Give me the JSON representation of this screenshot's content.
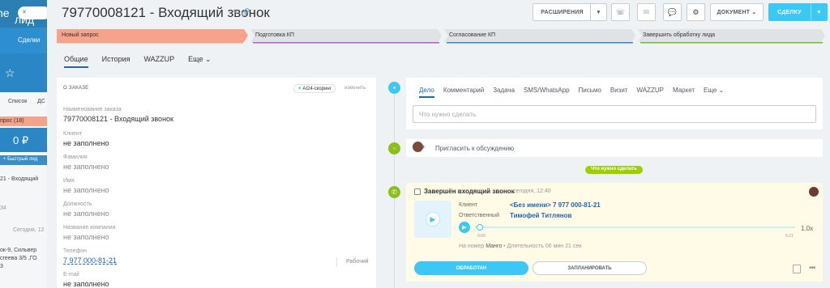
{
  "background": {
    "app_title_fragment": "ne",
    "filter_pill": "лид",
    "deals_label": "Сделки",
    "list_tab": "Список",
    "list_tab_short": "ДС",
    "stage_label": "прос (18)",
    "total_amount": "0 ₽",
    "quick_lead": "+ Быстрый лид",
    "lead_item": "21 - Входящий",
    "lead_item_number": "34",
    "today_label": "Сегодня, 12",
    "address_line1": "ок-9, Сильвер",
    "address_line2": "сгеева 3/5 ,ГО",
    "address_line3": "3"
  },
  "header": {
    "title": "79770008121 - Входящий звонок",
    "edit_icon": "pencil-icon",
    "btn_extensions": "РАСШИРЕНИЯ",
    "btn_dropdown_caret": "▾",
    "btn_phone_icon": "☏",
    "btn_mail_icon": "✉",
    "btn_chat_icon": "💬",
    "btn_settings_icon": "⚙",
    "btn_document": "ДОКУМЕНТ",
    "btn_document_caret": "⌄",
    "btn_deal": "СДЕЛКУ",
    "btn_deal_caret": "▾"
  },
  "stages": [
    {
      "label": "Новый запрос",
      "color": "#f5a38a",
      "underline": "#f5a38a"
    },
    {
      "label": "Подготовка КП",
      "color": "#dfe3e6",
      "underline": "#b457d1"
    },
    {
      "label": "Согласование КП",
      "color": "#dfe3e6",
      "underline": "#2f86d5"
    },
    {
      "label": "Завершить обработку лида",
      "color": "#dfe3e6",
      "underline": "#6cbf2a"
    }
  ],
  "tabs": [
    {
      "label": "Общие",
      "active": true
    },
    {
      "label": "История",
      "active": false
    },
    {
      "label": "WAZZUP",
      "active": false
    },
    {
      "label": "Еще ⌄",
      "active": false
    }
  ],
  "left_card": {
    "heading": "О ЗАКАЗЕ",
    "ai_badge": "AI24-скоринг",
    "change_link": "изменить",
    "fields": [
      {
        "label": "Наименование заказа",
        "value": "79770008121 - Входящий звонок",
        "style": ""
      },
      {
        "label": "Клиент",
        "value": "не заполнено",
        "style": ""
      },
      {
        "label": "Фамилия",
        "value": "не заполнено",
        "style": "muted"
      },
      {
        "label": "Имя",
        "value": "не заполнено",
        "style": "muted"
      },
      {
        "label": "Должность",
        "value": "не заполнено",
        "style": "muted"
      },
      {
        "label": "Название компании",
        "value": "не заполнено",
        "style": "muted"
      },
      {
        "label": "Телефон",
        "value": "7 977 000-81-21",
        "style": "link"
      },
      {
        "label": "E-mail",
        "value": "не заполнено",
        "style": ""
      }
    ],
    "phone_type": "Рабочий"
  },
  "activity": {
    "tabs": [
      "Дело",
      "Комментарий",
      "Задача",
      "SMS/WhatsApp",
      "Письмо",
      "Визит",
      "WAZZUP",
      "Маркет",
      "Еще ⌄"
    ],
    "input_placeholder": "Что нужно сделать",
    "discuss_text": "Пригласить к обсуждению",
    "todo_pill": "Что нужно сделать"
  },
  "call": {
    "title": "Завершён входящий звонок",
    "time": "сегодня, 12:40",
    "client_label": "Клиент",
    "client_value": "<Без имени> 7 977 000-81-21",
    "responsible_label": "Ответственный",
    "responsible_value": "Тимофей Титлянов",
    "time_start": "0:00",
    "time_end": "5:21",
    "speed": "1.0x",
    "info_prefix": "На номер",
    "info_number": "Манго",
    "info_suffix": "• Длительность 06 мин 21 сек",
    "btn_done": "ОБРАБОТАН",
    "btn_plan": "ЗАПЛАНИРОВАТЬ",
    "more": "•••",
    "progress": 0.0
  }
}
